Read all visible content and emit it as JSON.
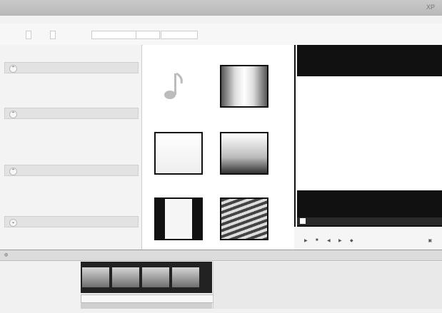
{
  "title_bar": {
    "title": "",
    "logo": "XP"
  },
  "menu": {
    "items": [
      "",
      "",
      "",
      "",
      "",
      "",
      ""
    ]
  },
  "toolbar": {
    "buttons": [
      "",
      "",
      "",
      "",
      ""
    ]
  },
  "left_pane": {
    "sections": [
      {
        "heading": "",
        "links": [
          "",
          "",
          "",
          ""
        ]
      },
      {
        "heading": "",
        "links": [
          "",
          "",
          "",
          ""
        ]
      },
      {
        "heading": "",
        "links": [
          "",
          "",
          "",
          "",
          ""
        ]
      },
      {
        "heading": "",
        "links": [
          ""
        ]
      }
    ]
  },
  "collections": {
    "title": "",
    "subtitle": "",
    "items": [
      {
        "label": "",
        "kind": "audio-note-icon"
      },
      {
        "label": "",
        "kind": "curtain-image"
      },
      {
        "label": "",
        "kind": "bars-image"
      },
      {
        "label": "",
        "kind": "city-image"
      },
      {
        "label": "",
        "kind": "clock-image"
      },
      {
        "label": "",
        "kind": "waves-image"
      }
    ]
  },
  "preview": {
    "title": "",
    "status_left": "",
    "status_right": ""
  },
  "timeline": {
    "header_text": "",
    "track_labels": [
      "",
      "",
      ""
    ]
  },
  "colors": {
    "titlebar": "#bebebe",
    "preview_bg": "#111111"
  }
}
